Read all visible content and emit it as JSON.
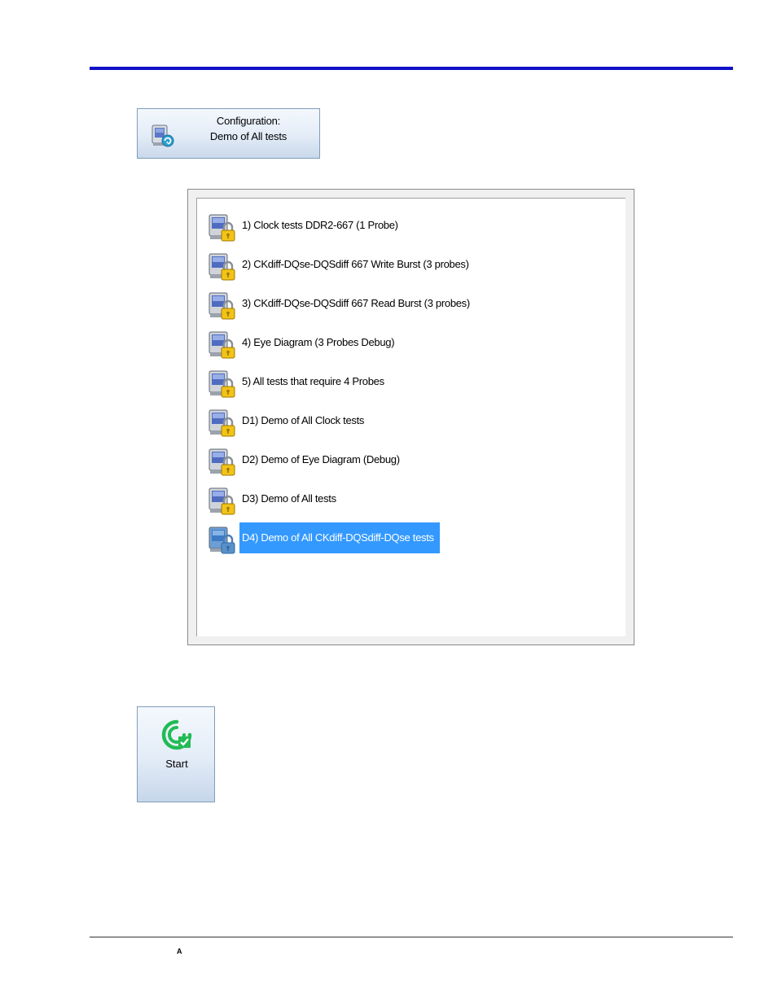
{
  "colors": {
    "accent_rule": "#1010c8",
    "selection": "#3399ff",
    "button_border": "#7f9db9",
    "start_icon": "#22bb55"
  },
  "configuration_button": {
    "icon": "configuration-icon",
    "line1": "Configuration:",
    "line2": "Demo of All tests"
  },
  "config_list": {
    "items": [
      {
        "label": "1) Clock tests DDR2-667 (1 Probe)",
        "icon": "locked-config-icon",
        "selected": false
      },
      {
        "label": "2) CKdiff-DQse-DQSdiff 667 Write Burst (3 probes)",
        "icon": "locked-config-icon",
        "selected": false
      },
      {
        "label": "3) CKdiff-DQse-DQSdiff 667 Read Burst (3 probes)",
        "icon": "locked-config-icon",
        "selected": false
      },
      {
        "label": "4) Eye Diagram (3 Probes Debug)",
        "icon": "locked-config-icon",
        "selected": false
      },
      {
        "label": "5) All tests that require 4 Probes",
        "icon": "locked-config-icon",
        "selected": false
      },
      {
        "label": "D1) Demo of All Clock tests",
        "icon": "locked-config-icon",
        "selected": false
      },
      {
        "label": "D2) Demo of Eye Diagram (Debug)",
        "icon": "locked-config-icon",
        "selected": false
      },
      {
        "label": "D3) Demo of All tests",
        "icon": "locked-config-icon",
        "selected": false
      },
      {
        "label": "D4) Demo of All CKdiff-DQSdiff-DQse tests",
        "icon": "locked-config-icon",
        "selected": true
      }
    ]
  },
  "start_button": {
    "icon": "start-icon",
    "label": "Start"
  },
  "footer": {
    "mark": "A"
  }
}
